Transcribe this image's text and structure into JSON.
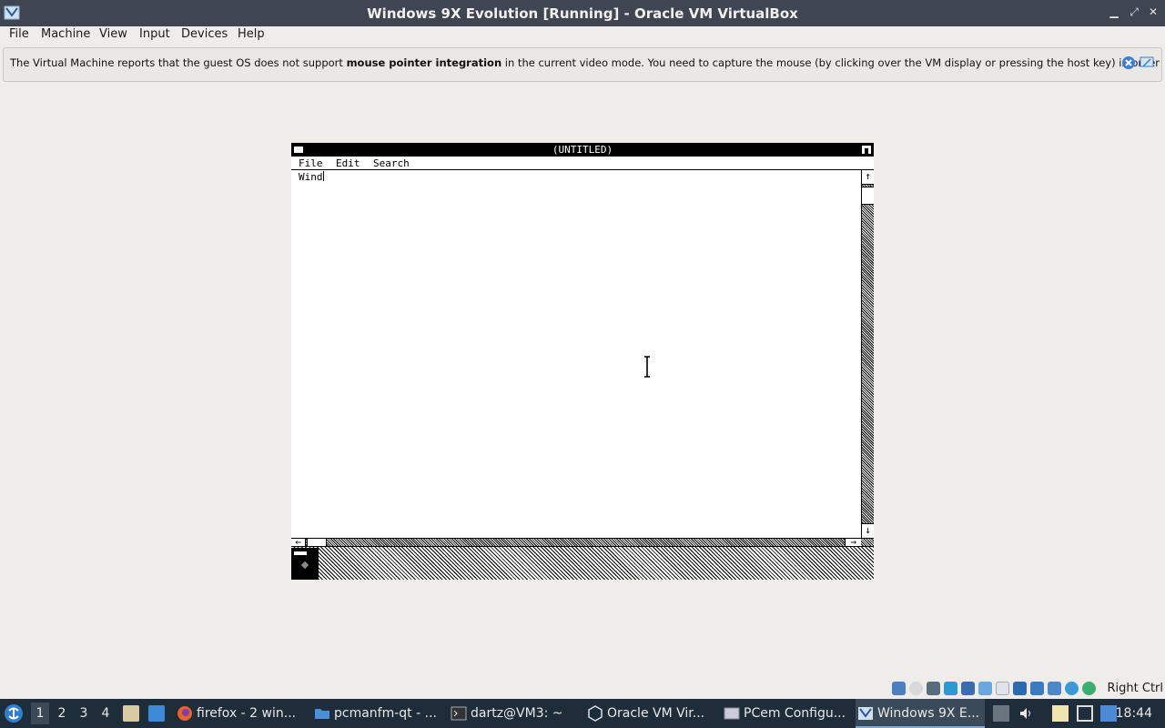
{
  "window": {
    "title": "Windows 9X Evolution [Running] - Oracle VM VirtualBox",
    "minimize_glyph": "▁",
    "maximize_glyph": "⤢",
    "close_glyph": "✕"
  },
  "menubar": [
    "File",
    "Machine",
    "View",
    "Input",
    "Devices",
    "Help"
  ],
  "banner": {
    "text_before": "The Virtual Machine reports that the guest OS does not support ",
    "text_bold": "mouse pointer integration",
    "text_after": " in the current video mode. You need to capture the mouse (by clicking over the VM display or pressing the host key) in order"
  },
  "guest": {
    "window_title": "(UNTITLED)",
    "menu": [
      "File",
      "Edit",
      "Search"
    ],
    "document_text": "Wind",
    "scroll_up": "↑",
    "scroll_down": "↓",
    "scroll_left": "←",
    "scroll_right": "→"
  },
  "statusbar": {
    "host_key": "Right Ctrl",
    "icons": [
      "hard-disk-icon",
      "optical-drive-icon",
      "floppy-icon",
      "audio-icon",
      "network-icon",
      "usb-icon",
      "shared-folders-icon",
      "display-icon",
      "video-capture-icon",
      "guest-additions-icon",
      "cpu-icon",
      "mouse-integration-icon",
      "keyboard-capture-icon"
    ]
  },
  "taskbar": {
    "workspaces": [
      "1",
      "2",
      "3",
      "4"
    ],
    "active_workspace": "1",
    "tasks": [
      {
        "label": "firefox - 2 win...",
        "icon": "firefox-icon"
      },
      {
        "label": "pcmanfm-qt - ...",
        "icon": "folder-icon"
      },
      {
        "label": "dartz@VM3: ~",
        "icon": "terminal-icon"
      },
      {
        "label": "Oracle VM Vir...",
        "icon": "virtualbox-icon"
      },
      {
        "label": "PCem Configu...",
        "icon": "window-icon"
      },
      {
        "label": "Windows 9X E...",
        "icon": "virtualbox-vm-icon"
      }
    ],
    "clock": "18:44"
  },
  "colors": {
    "titlebar": "#404552",
    "taskbar": "#1f2d3a",
    "background": "#efedea"
  }
}
